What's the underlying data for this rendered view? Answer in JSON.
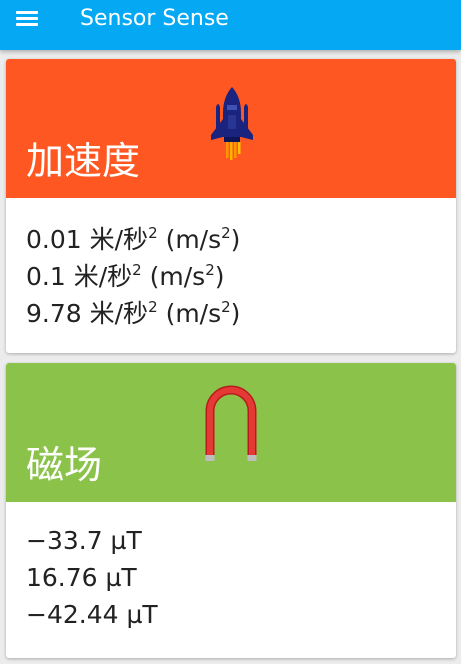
{
  "app": {
    "title": "Sensor Sense"
  },
  "cards": [
    {
      "title": "加速度",
      "icon": "rocket-icon",
      "color": "#ff5722",
      "readings": [
        {
          "value": "0.01",
          "unit": "米/秒",
          "exp": "2",
          "unit_alt": "(m/s",
          "exp_alt": "2",
          "close": ")"
        },
        {
          "value": "0.1",
          "unit": "米/秒",
          "exp": "2",
          "unit_alt": "(m/s",
          "exp_alt": "2",
          "close": ")"
        },
        {
          "value": "9.78",
          "unit": "米/秒",
          "exp": "2",
          "unit_alt": "(m/s",
          "exp_alt": "2",
          "close": ")"
        }
      ]
    },
    {
      "title": "磁场",
      "icon": "magnet-icon",
      "color": "#8bc34a",
      "readings": [
        {
          "text": "−33.7 µT"
        },
        {
          "text": "16.76 µT"
        },
        {
          "text": "−42.44 µT"
        }
      ]
    }
  ],
  "colors": {
    "appbar": "#05a9f3",
    "accel_header": "#ff5722",
    "magnet_header": "#8bc34a"
  }
}
